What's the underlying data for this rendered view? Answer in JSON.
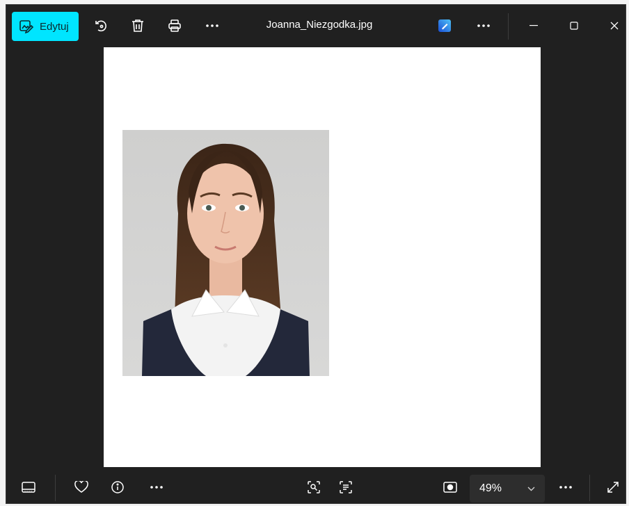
{
  "toolbar": {
    "edit_label": "Edytuj",
    "title": "Joanna_Niezgodka.jpg"
  },
  "icons": {
    "edit": "edit-image-icon",
    "rotate": "rotate-icon",
    "delete": "trash-icon",
    "print": "print-icon",
    "more": "more-icon",
    "designer": "designer-app-icon",
    "minimize": "minimize-icon",
    "maximize": "maximize-icon",
    "close": "close-icon",
    "filmstrip": "filmstrip-icon",
    "favorite": "heart-icon",
    "info": "info-icon",
    "visual_search": "visual-search-icon",
    "text_scan": "text-scan-icon",
    "fit": "fit-to-window-icon",
    "zoom_dropdown": "chevron-down-icon",
    "fullscreen": "fullscreen-icon"
  },
  "statusbar": {
    "zoom_value": "49%"
  },
  "colors": {
    "accent": "#00e5ff",
    "window_bg": "#202020",
    "canvas_bg": "#ffffff",
    "zoom_bg": "#2d2d2d"
  }
}
